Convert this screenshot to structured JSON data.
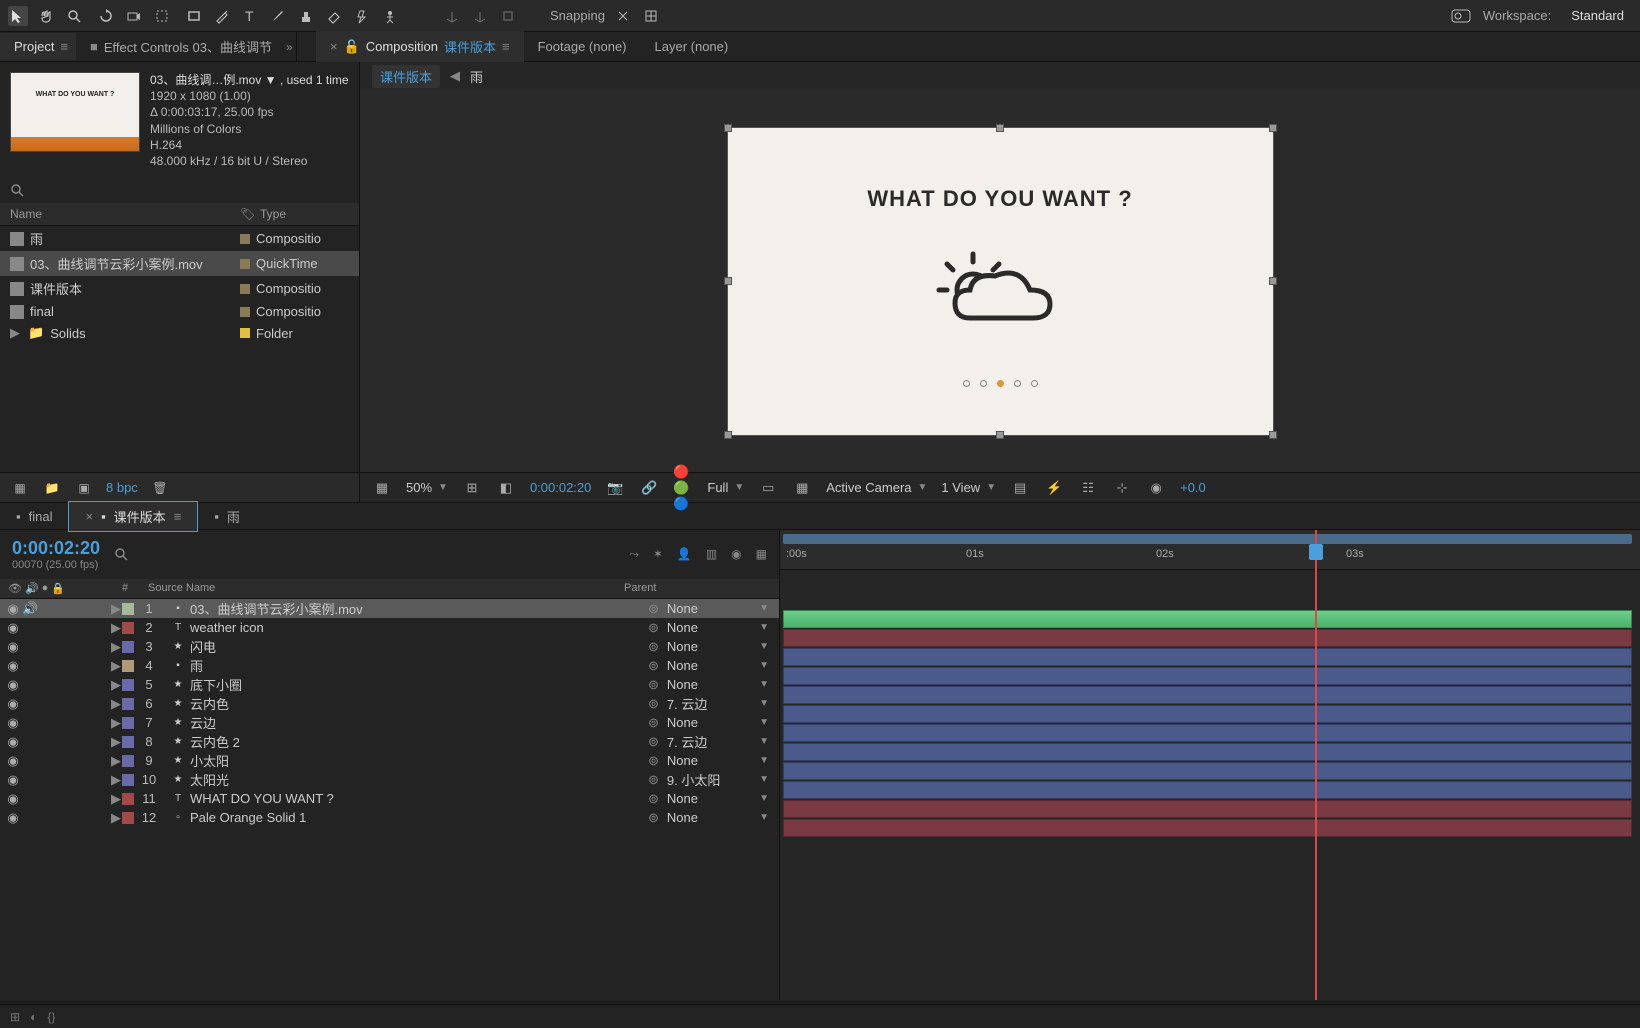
{
  "toolbar": {
    "snapping": "Snapping",
    "workspace_label": "Workspace:",
    "workspace_value": "Standard"
  },
  "project_panel": {
    "tab": "Project",
    "effect_tab": "Effect Controls 03、曲线调节",
    "asset": {
      "name_line": "03、曲线调…例.mov ▼ , used 1 time",
      "dims": "1920 x 1080 (1.00)",
      "duration": "Δ 0:00:03:17, 25.00 fps",
      "colors": "Millions of Colors",
      "codec": "H.264",
      "audio": "48.000 kHz / 16 bit U / Stereo",
      "thumb_text": "WHAT DO YOU WANT ?"
    },
    "columns": {
      "name": "Name",
      "type": "Type"
    },
    "rows": [
      {
        "name": "雨",
        "type": "Compositio"
      },
      {
        "name": "03、曲线调节云彩小案例.mov",
        "type": "QuickTime",
        "selected": true
      },
      {
        "name": "课件版本",
        "type": "Compositio"
      },
      {
        "name": "final",
        "type": "Compositio"
      },
      {
        "name": "Solids",
        "type": "Folder",
        "folder": true
      }
    ],
    "bpc": "8 bpc"
  },
  "comp_panel": {
    "tab_prefix": "Composition",
    "tab_name": "课件版本",
    "footage_tab": "Footage (none)",
    "layer_tab": "Layer (none)",
    "nav_current": "课件版本",
    "nav_child": "雨",
    "canvas_title": "WHAT DO YOU WANT ?"
  },
  "viewer_footer": {
    "zoom": "50%",
    "time": "0:00:02:20",
    "resolution": "Full",
    "camera": "Active Camera",
    "views": "1 View",
    "exposure": "+0.0"
  },
  "timeline": {
    "tabs": [
      "final",
      "课件版本",
      "雨"
    ],
    "active_tab": 1,
    "time": "0:00:02:20",
    "frames": "00070 (25.00 fps)",
    "col_num": "#",
    "col_name": "Source Name",
    "col_parent": "Parent",
    "ruler": [
      ":00s",
      "01s",
      "02s",
      "03s"
    ],
    "layers": [
      {
        "num": "1",
        "name": "03、曲线调节云彩小案例.mov",
        "parent": "None",
        "color": "#a8b89a",
        "icon": "▪",
        "selected": true,
        "bar": "vid"
      },
      {
        "num": "2",
        "name": "weather icon",
        "parent": "None",
        "color": "#a04a4a",
        "icon": "T",
        "bar": "red"
      },
      {
        "num": "3",
        "name": "闪电",
        "parent": "None",
        "color": "#6a6aa8",
        "icon": "★",
        "bar": "blue"
      },
      {
        "num": "4",
        "name": "雨",
        "parent": "None",
        "color": "#b09a7a",
        "icon": "▪",
        "bar": "blue"
      },
      {
        "num": "5",
        "name": "底下小圈",
        "parent": "None",
        "color": "#6a6aa8",
        "icon": "★",
        "bar": "blue"
      },
      {
        "num": "6",
        "name": "云内色",
        "parent": "7. 云边",
        "color": "#6a6aa8",
        "icon": "★",
        "bar": "blue"
      },
      {
        "num": "7",
        "name": "云边",
        "parent": "None",
        "color": "#6a6aa8",
        "icon": "★",
        "bar": "blue"
      },
      {
        "num": "8",
        "name": "云内色  2",
        "parent": "7. 云边",
        "color": "#6a6aa8",
        "icon": "★",
        "bar": "blue"
      },
      {
        "num": "9",
        "name": "小太阳",
        "parent": "None",
        "color": "#6a6aa8",
        "icon": "★",
        "bar": "blue"
      },
      {
        "num": "10",
        "name": "太阳光",
        "parent": "9. 小太阳",
        "color": "#6a6aa8",
        "icon": "★",
        "bar": "blue"
      },
      {
        "num": "11",
        "name": "WHAT DO YOU WANT ?",
        "parent": "None",
        "color": "#a04a4a",
        "icon": "T",
        "bar": "red"
      },
      {
        "num": "12",
        "name": "Pale Orange Solid 1",
        "parent": "None",
        "color": "#a04a4a",
        "icon": "▫",
        "bar": "red"
      }
    ]
  }
}
